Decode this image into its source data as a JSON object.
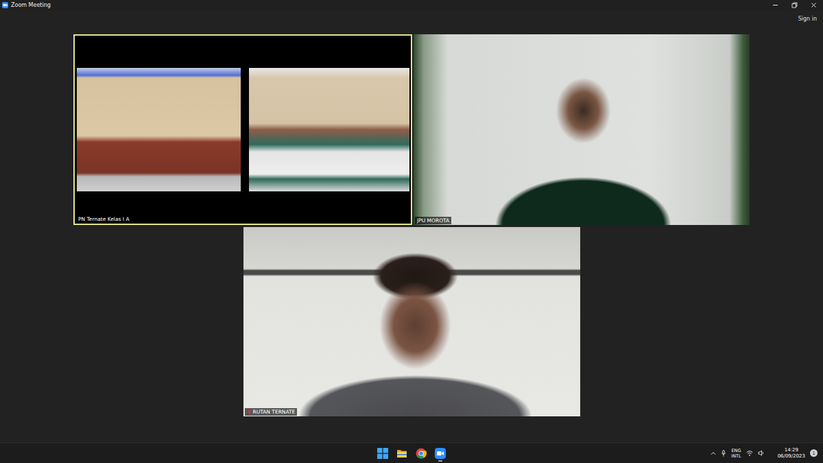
{
  "window": {
    "title": "Zoom Meeting"
  },
  "account": {
    "sign_in": "Sign in"
  },
  "participants": [
    {
      "name": "PN Ternate Kelas I A",
      "active_speaker": true,
      "muted": false
    },
    {
      "name": "JPU MOROTA",
      "active_speaker": false,
      "muted": false
    },
    {
      "name": "RUTAN TERNATE",
      "active_speaker": false,
      "muted": true
    }
  ],
  "taskbar": {
    "apps": [
      {
        "kind": "start",
        "running": false
      },
      {
        "kind": "explorer",
        "running": false
      },
      {
        "kind": "chrome",
        "running": false
      },
      {
        "kind": "zoom",
        "running": true
      }
    ],
    "language": [
      "ENG",
      "INTL"
    ],
    "time": "14:29",
    "date": "06/09/2023",
    "notifications": "1"
  }
}
